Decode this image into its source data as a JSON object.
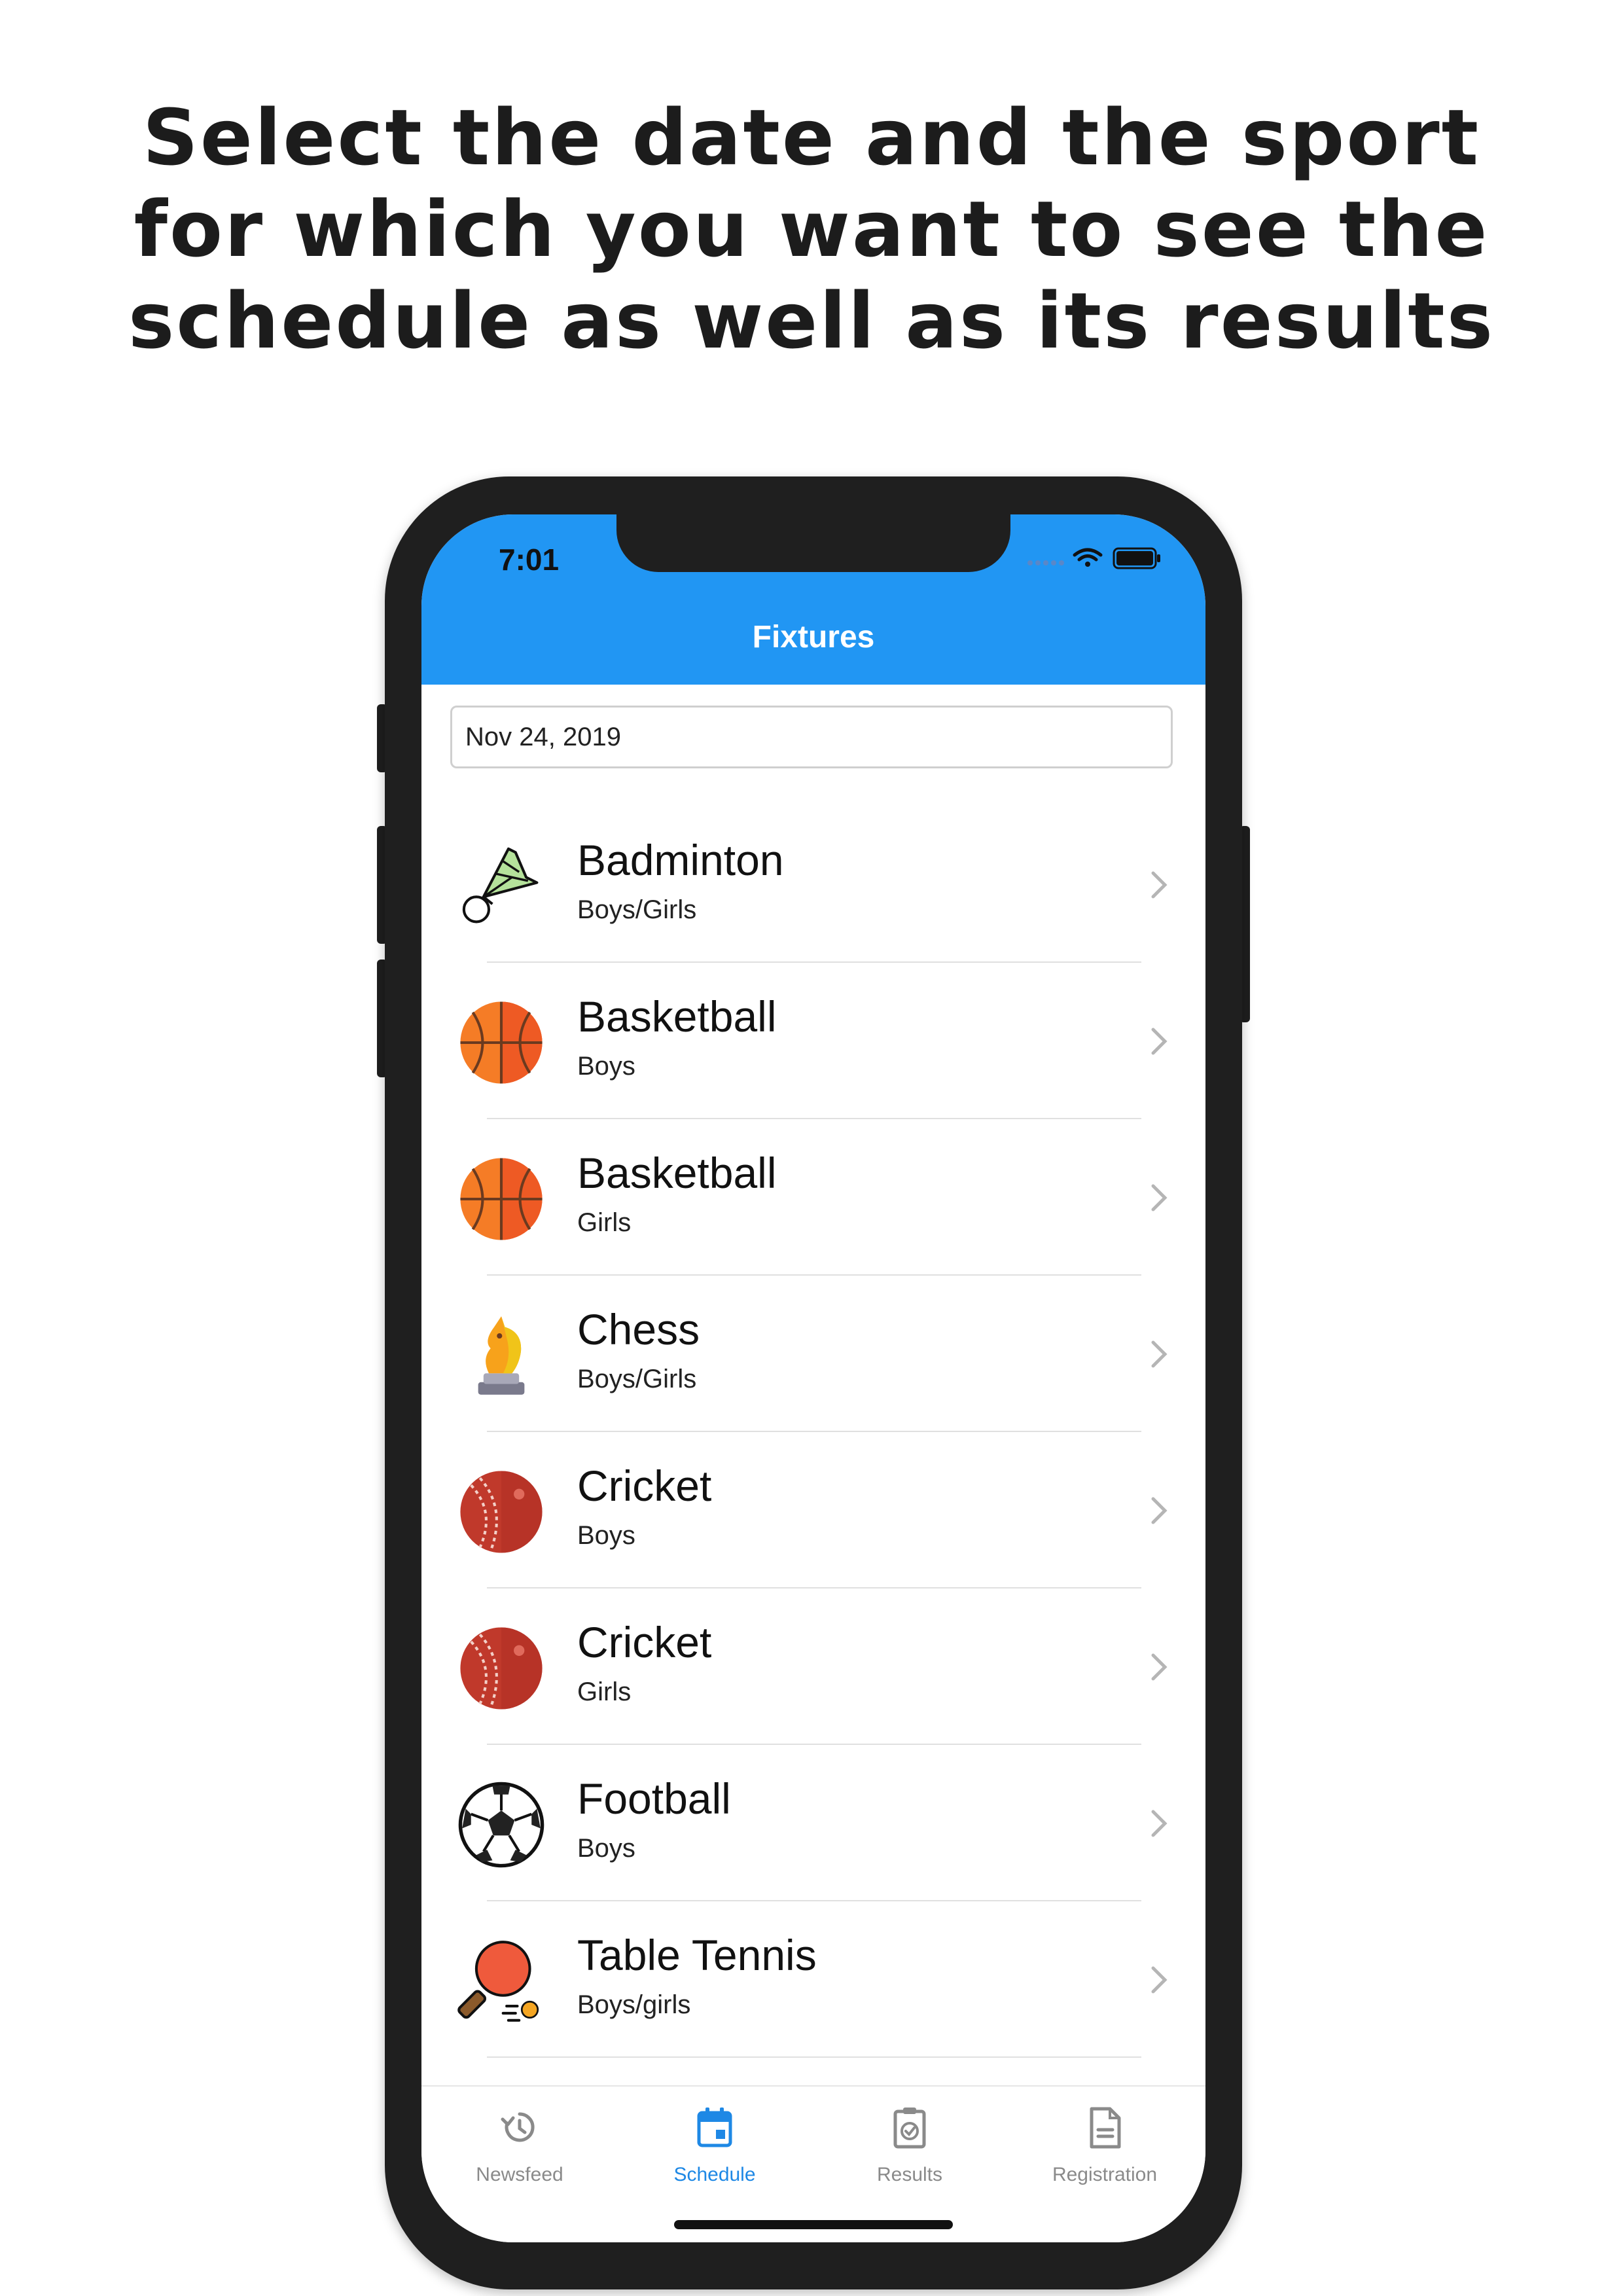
{
  "headline": {
    "line1": "Select the date and the sport",
    "line2": "for which you want to see the",
    "line3": "schedule as well as its results"
  },
  "status_bar": {
    "time": "7:01",
    "icons": [
      "signal-dots-icon",
      "wifi-icon",
      "battery-icon"
    ]
  },
  "app_bar": {
    "title": "Fixtures",
    "color": "#2196f3"
  },
  "date_picker": {
    "value": "Nov 24, 2019"
  },
  "sports": [
    {
      "title": "Badminton",
      "subtitle": "Boys/Girls",
      "icon": "shuttlecock-icon"
    },
    {
      "title": "Basketball",
      "subtitle": "Boys",
      "icon": "basketball-icon"
    },
    {
      "title": "Basketball",
      "subtitle": "Girls",
      "icon": "basketball-icon"
    },
    {
      "title": "Chess",
      "subtitle": "Boys/Girls",
      "icon": "chess-knight-icon"
    },
    {
      "title": "Cricket",
      "subtitle": "Boys",
      "icon": "cricket-ball-icon"
    },
    {
      "title": "Cricket",
      "subtitle": "Girls",
      "icon": "cricket-ball-icon"
    },
    {
      "title": "Football",
      "subtitle": "Boys",
      "icon": "football-icon"
    },
    {
      "title": "Table Tennis",
      "subtitle": "Boys/girls",
      "icon": "table-tennis-icon"
    }
  ],
  "tabs": [
    {
      "label": "Newsfeed",
      "icon": "history-icon",
      "active": false
    },
    {
      "label": "Schedule",
      "icon": "calendar-icon",
      "active": true
    },
    {
      "label": "Results",
      "icon": "clipboard-check-icon",
      "active": false
    },
    {
      "label": "Registration",
      "icon": "document-icon",
      "active": false
    }
  ],
  "colors": {
    "accent": "#1e88e5",
    "inactive": "#8a8a8a"
  }
}
